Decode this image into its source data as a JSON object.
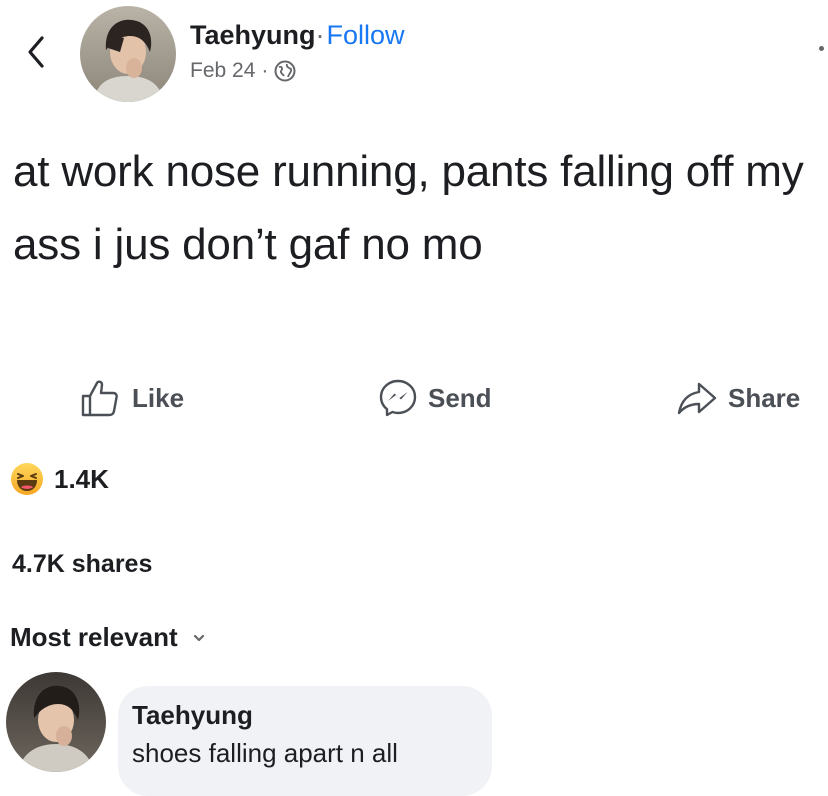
{
  "header": {
    "author": "Taehyung",
    "separator": "·",
    "follow_label": "Follow",
    "date": "Feb 24",
    "meta_separator": "·",
    "privacy_icon": "globe-icon",
    "back_icon": "chevron-left-icon",
    "more_icon": "more-icon"
  },
  "post": {
    "text": "at work nose running, pants falling off my ass i jus don’t gaf no mo"
  },
  "actions": {
    "like_label": "Like",
    "send_label": "Send",
    "share_label": "Share",
    "like_icon": "thumbs-up-icon",
    "send_icon": "messenger-icon",
    "share_icon": "share-arrow-icon"
  },
  "reactions": {
    "icon": "haha-reaction-icon",
    "count": "1.4K"
  },
  "shares": {
    "text": "4.7K shares"
  },
  "comments": {
    "sort_label": "Most relevant",
    "sort_icon": "chevron-down-icon",
    "items": [
      {
        "author": "Taehyung",
        "text": "shoes falling apart n all"
      }
    ]
  },
  "colors": {
    "accent": "#1877f2",
    "secondary_text": "#65676b",
    "comment_bg": "#f0f2f5",
    "reaction_yellow": "#f7b125"
  }
}
